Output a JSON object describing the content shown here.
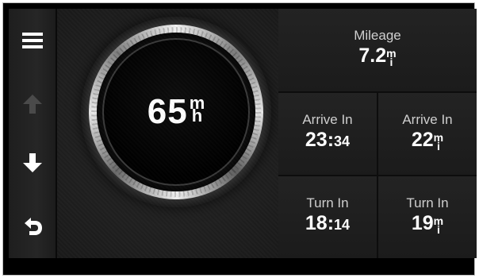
{
  "toolbar": {
    "menu_icon": "hamburger-menu-icon",
    "up_icon": "arrow-up-icon",
    "down_icon": "arrow-down-icon",
    "back_icon": "back-arrow-icon"
  },
  "gauge": {
    "speed_value": "65",
    "speed_unit_top": "m",
    "speed_unit_bottom": "h"
  },
  "fields": {
    "mileage": {
      "label": "Mileage",
      "value_main": "7.2",
      "unit_top": "m",
      "unit_bottom": "i"
    },
    "arrive_time": {
      "label": "Arrive In",
      "value_main": "23:",
      "value_small": "34"
    },
    "arrive_dist": {
      "label": "Arrive In",
      "value_main": "22",
      "unit_top": "m",
      "unit_bottom": "i"
    },
    "turn_time": {
      "label": "Turn In",
      "value_main": "18:",
      "value_small": "14"
    },
    "turn_dist": {
      "label": "Turn In",
      "value_main": "19",
      "unit_top": "m",
      "unit_bottom": "i"
    }
  },
  "colors": {
    "background": "#151515",
    "text": "#ffffff",
    "label": "#cfcfcf",
    "up_disabled": "#4a4a4a"
  }
}
